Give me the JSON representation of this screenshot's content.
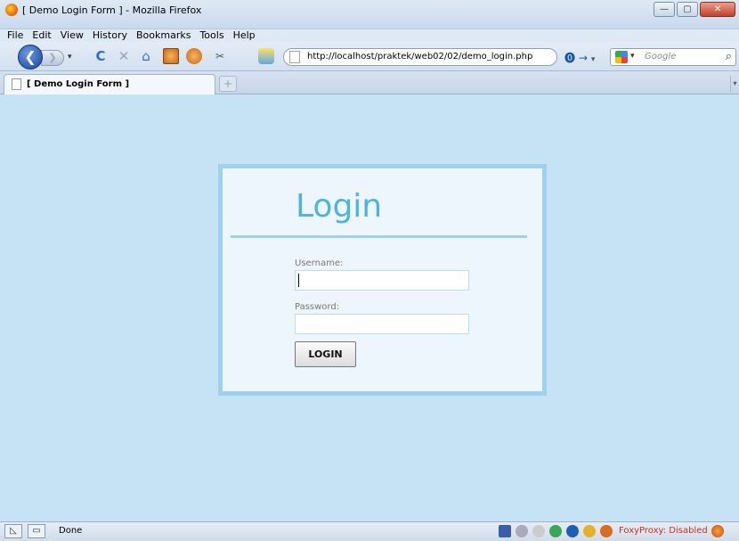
{
  "window": {
    "title": "[ Demo Login Form ] - Mozilla Firefox",
    "min_label": "—",
    "max_label": "▢",
    "close_label": "✕"
  },
  "menu": {
    "items": [
      "File",
      "Edit",
      "View",
      "History",
      "Bookmarks",
      "Tools",
      "Help"
    ],
    "accelerators": [
      "F",
      "E",
      "V",
      "s",
      "B",
      "T",
      "H"
    ]
  },
  "toolbar": {
    "back_glyph": "❮",
    "forward_glyph": "❯",
    "dropdown_glyph": "▾",
    "reload_glyph": "C",
    "stop_glyph": "✕",
    "home_glyph": "⌂",
    "ext3_glyph": "✂",
    "url": "http://localhost/praktek/web02/02/demo_login.php",
    "go_glyphs": "⓿ →",
    "go_dropdown": "▾",
    "search_placeholder": "Google",
    "search_dropdown": "▾",
    "search_glyph": "⌕"
  },
  "tabs": {
    "items": [
      {
        "label": "[ Demo Login Form ]"
      }
    ],
    "new_tab_glyph": "+",
    "list_glyph": "▾"
  },
  "login": {
    "title": "Login",
    "username_label": "Username:",
    "username_value": "",
    "password_label": "Password:",
    "password_value": "",
    "button_label": "LOGIN"
  },
  "status": {
    "text": "Done",
    "btn1_glyph": "◺",
    "btn2_glyph": "▭",
    "foxyproxy": "FoxyProxy: Disabled"
  },
  "colors": {
    "page_bg": "#c6e3f6",
    "card_bg": "#eef6fd",
    "card_border": "#9fd1ee",
    "title_color": "#4fb2e0"
  }
}
